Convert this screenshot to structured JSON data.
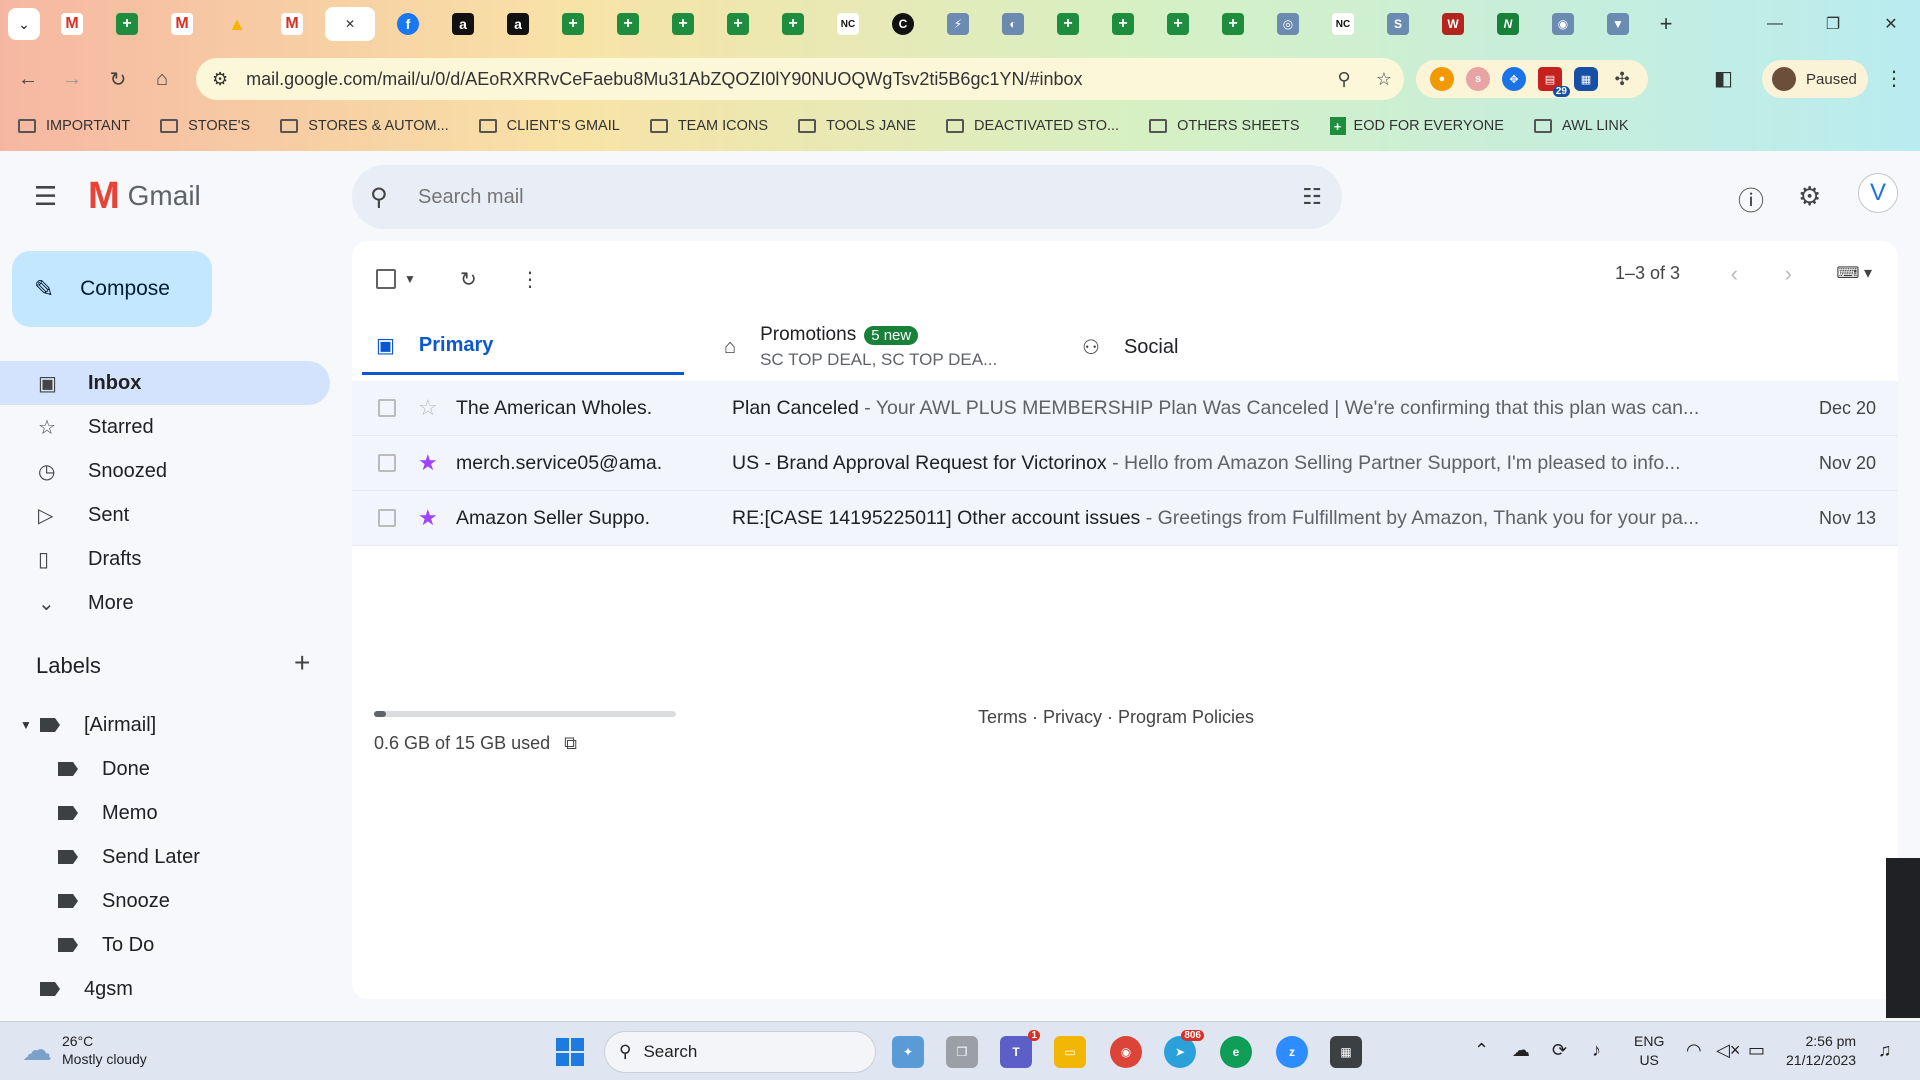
{
  "browser": {
    "tabs": [
      {
        "icon": "gmail-icon",
        "glyph": "M"
      },
      {
        "icon": "sheets-icon",
        "glyph": "+"
      },
      {
        "icon": "gmail-icon",
        "glyph": "M"
      },
      {
        "icon": "drive-icon",
        "glyph": "▲"
      },
      {
        "icon": "gmail-icon",
        "glyph": "M"
      },
      {
        "icon": "close-icon",
        "glyph": "✕"
      },
      {
        "icon": "facebook-icon",
        "glyph": "f"
      },
      {
        "icon": "amazon-icon",
        "glyph": "a"
      },
      {
        "icon": "amazon-icon",
        "glyph": "a"
      },
      {
        "icon": "sheets-icon",
        "glyph": "+"
      },
      {
        "icon": "sheets-icon",
        "glyph": "+"
      },
      {
        "icon": "sheets-icon",
        "glyph": "+"
      },
      {
        "icon": "sheets-icon",
        "glyph": "+"
      },
      {
        "icon": "sheets-icon",
        "glyph": "+"
      },
      {
        "icon": "nc-icon",
        "glyph": "NC"
      },
      {
        "icon": "c-icon",
        "glyph": "C"
      },
      {
        "icon": "tool-icon",
        "glyph": "⚡"
      },
      {
        "icon": "globe-icon",
        "glyph": "◐"
      },
      {
        "icon": "sheets-icon",
        "glyph": "+"
      },
      {
        "icon": "sheets-icon",
        "glyph": "+"
      },
      {
        "icon": "sheets-icon",
        "glyph": "+"
      },
      {
        "icon": "sheets-icon",
        "glyph": "+"
      },
      {
        "icon": "app-icon",
        "glyph": "◎"
      },
      {
        "icon": "nc-icon",
        "glyph": "NC"
      },
      {
        "icon": "sysco-icon",
        "glyph": "S"
      },
      {
        "icon": "wolters-icon",
        "glyph": "W"
      },
      {
        "icon": "n-icon",
        "glyph": "N"
      },
      {
        "icon": "app-icon",
        "glyph": "◉"
      },
      {
        "icon": "app-icon",
        "glyph": "▼"
      }
    ],
    "url": "mail.google.com/mail/u/0/d/AEoRXRRvCeFaebu8Mu31AbZQOZI0lY90NUOQWgTsv2ti5B6gc1YN/#inbox",
    "profile_status": "Paused",
    "extension_badge": "29",
    "bookmarks": [
      {
        "label": "IMPORTANT",
        "type": "folder"
      },
      {
        "label": "STORE'S",
        "type": "folder"
      },
      {
        "label": "STORES & AUTOM...",
        "type": "folder"
      },
      {
        "label": "CLIENT'S GMAIL",
        "type": "folder"
      },
      {
        "label": "TEAM ICONS",
        "type": "folder"
      },
      {
        "label": "TOOLS JANE",
        "type": "folder"
      },
      {
        "label": "DEACTIVATED STO...",
        "type": "folder"
      },
      {
        "label": "OTHERS SHEETS",
        "type": "folder"
      },
      {
        "label": "EOD FOR EVERYONE",
        "type": "sheet"
      },
      {
        "label": "AWL LINK",
        "type": "folder"
      }
    ]
  },
  "gmail": {
    "brand": "Gmail",
    "search_placeholder": "Search mail",
    "avatar_letter": "V",
    "compose_label": "Compose",
    "nav": [
      {
        "label": "Inbox",
        "icon": "inbox-icon",
        "glyph": "▣",
        "active": true
      },
      {
        "label": "Starred",
        "icon": "star-icon",
        "glyph": "☆",
        "active": false
      },
      {
        "label": "Snoozed",
        "icon": "clock-icon",
        "glyph": "◷",
        "active": false
      },
      {
        "label": "Sent",
        "icon": "send-icon",
        "glyph": "▷",
        "active": false
      },
      {
        "label": "Drafts",
        "icon": "draft-icon",
        "glyph": "▯",
        "active": false
      },
      {
        "label": "More",
        "icon": "chevron-down-icon",
        "glyph": "⌄",
        "active": false
      }
    ],
    "labels_title": "Labels",
    "labels": [
      {
        "label": "[Airmail]",
        "level": 0,
        "expanded": true
      },
      {
        "label": "Done",
        "level": 1
      },
      {
        "label": "Memo",
        "level": 1
      },
      {
        "label": "Send Later",
        "level": 1
      },
      {
        "label": "Snooze",
        "level": 1
      },
      {
        "label": "To Do",
        "level": 1
      },
      {
        "label": "4gsm",
        "level": 0
      }
    ],
    "pager": "1–3 of 3",
    "tabs": {
      "primary": "Primary",
      "promotions": "Promotions",
      "promotions_badge": "5 new",
      "promotions_sub": "SC TOP DEAL, SC TOP DEA...",
      "social": "Social"
    },
    "emails": [
      {
        "sender": "The American Wholes.",
        "subject": "Plan Canceled",
        "snippet": " - Your AWL PLUS MEMBERSHIP Plan Was Canceled | We're confirming that this plan was can...",
        "date": "Dec 20",
        "starred": false
      },
      {
        "sender": "merch.service05@ama.",
        "subject": "US - Brand Approval Request for Victorinox",
        "snippet": " - Hello from Amazon Selling Partner Support, I'm pleased to info...",
        "date": "Nov 20",
        "starred": true
      },
      {
        "sender": "Amazon Seller Suppo.",
        "subject": "RE:[CASE 14195225011] Other account issues",
        "snippet": " - Greetings from Fulfillment by Amazon, Thank you for your pa...",
        "date": "Nov 13",
        "starred": true
      }
    ],
    "storage_text": "0.6 GB of 15 GB used",
    "storage_fraction": 0.04,
    "footer_links": "Terms · Privacy · Program Policies"
  },
  "taskbar": {
    "temperature": "26°C",
    "weather": "Mostly cloudy",
    "search_label": "Search",
    "telegram_badge": "806",
    "teams_badge": "1",
    "lang_line1": "ENG",
    "lang_line2": "US",
    "time": "2:56 pm",
    "date": "21/12/2023"
  }
}
